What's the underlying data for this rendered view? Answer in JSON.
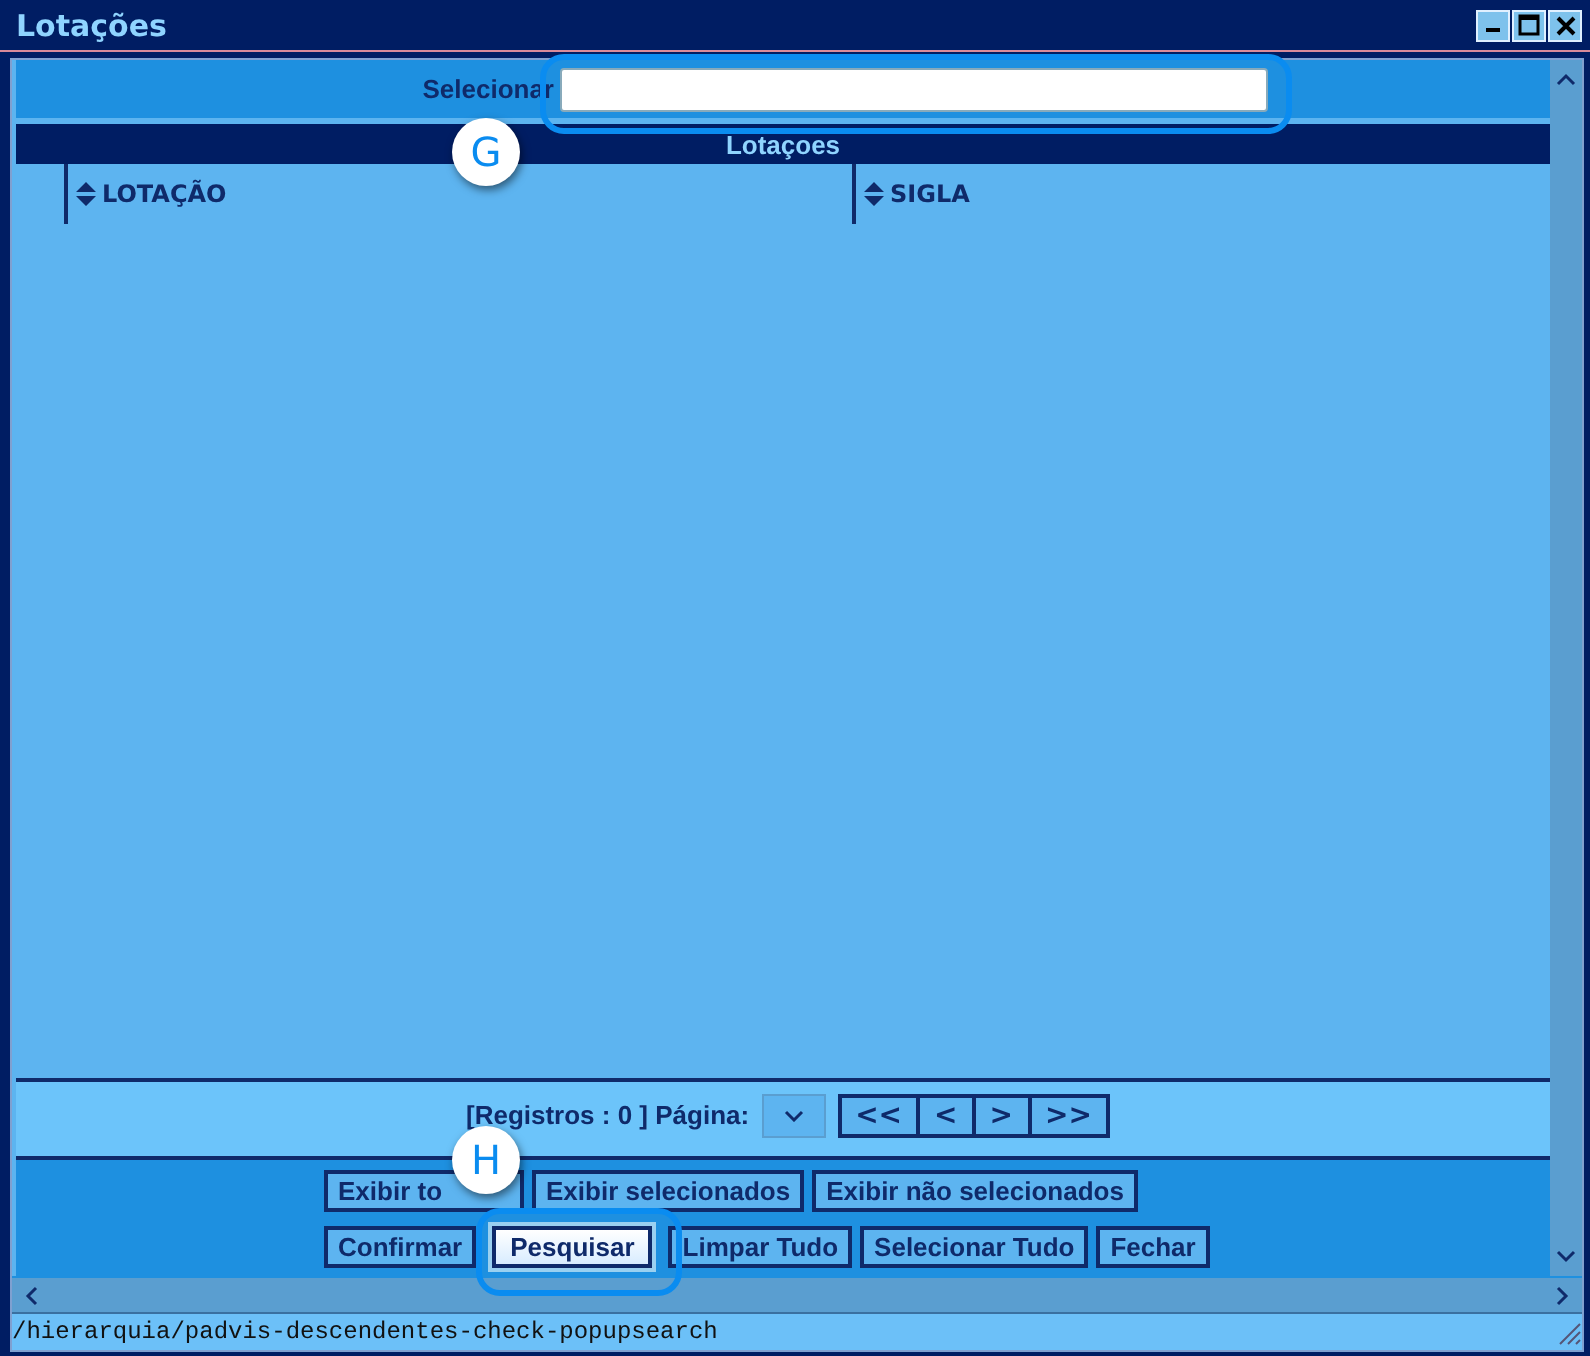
{
  "window": {
    "title": "Lotações"
  },
  "selector": {
    "label": "Selecionar"
  },
  "table": {
    "caption": "Lotaçoes",
    "columns": [
      "LOTAÇÃO",
      "SIGLA"
    ]
  },
  "pager": {
    "summary": "[Registros : 0 ] Página:",
    "buttons": [
      "<<",
      "<",
      ">",
      ">>"
    ]
  },
  "buttons_row_1": [
    {
      "label": "Exibir to",
      "selected": false
    },
    {
      "label": "Exibir selecionados",
      "selected": false
    },
    {
      "label": "Exibir não selecionados",
      "selected": false
    }
  ],
  "buttons_row_2": [
    {
      "label": "Confirmar",
      "selected": false
    },
    {
      "label": "Pesquisar",
      "selected": true
    },
    {
      "label": "Limpar Tudo",
      "selected": false
    },
    {
      "label": "Selecionar Tudo",
      "selected": false
    },
    {
      "label": "Fechar",
      "selected": false
    }
  ],
  "status_bar": {
    "text": "/hierarquia/padvis-descendentes-check-popupsearch"
  },
  "callouts": [
    {
      "label": "G"
    },
    {
      "label": "H"
    }
  ]
}
